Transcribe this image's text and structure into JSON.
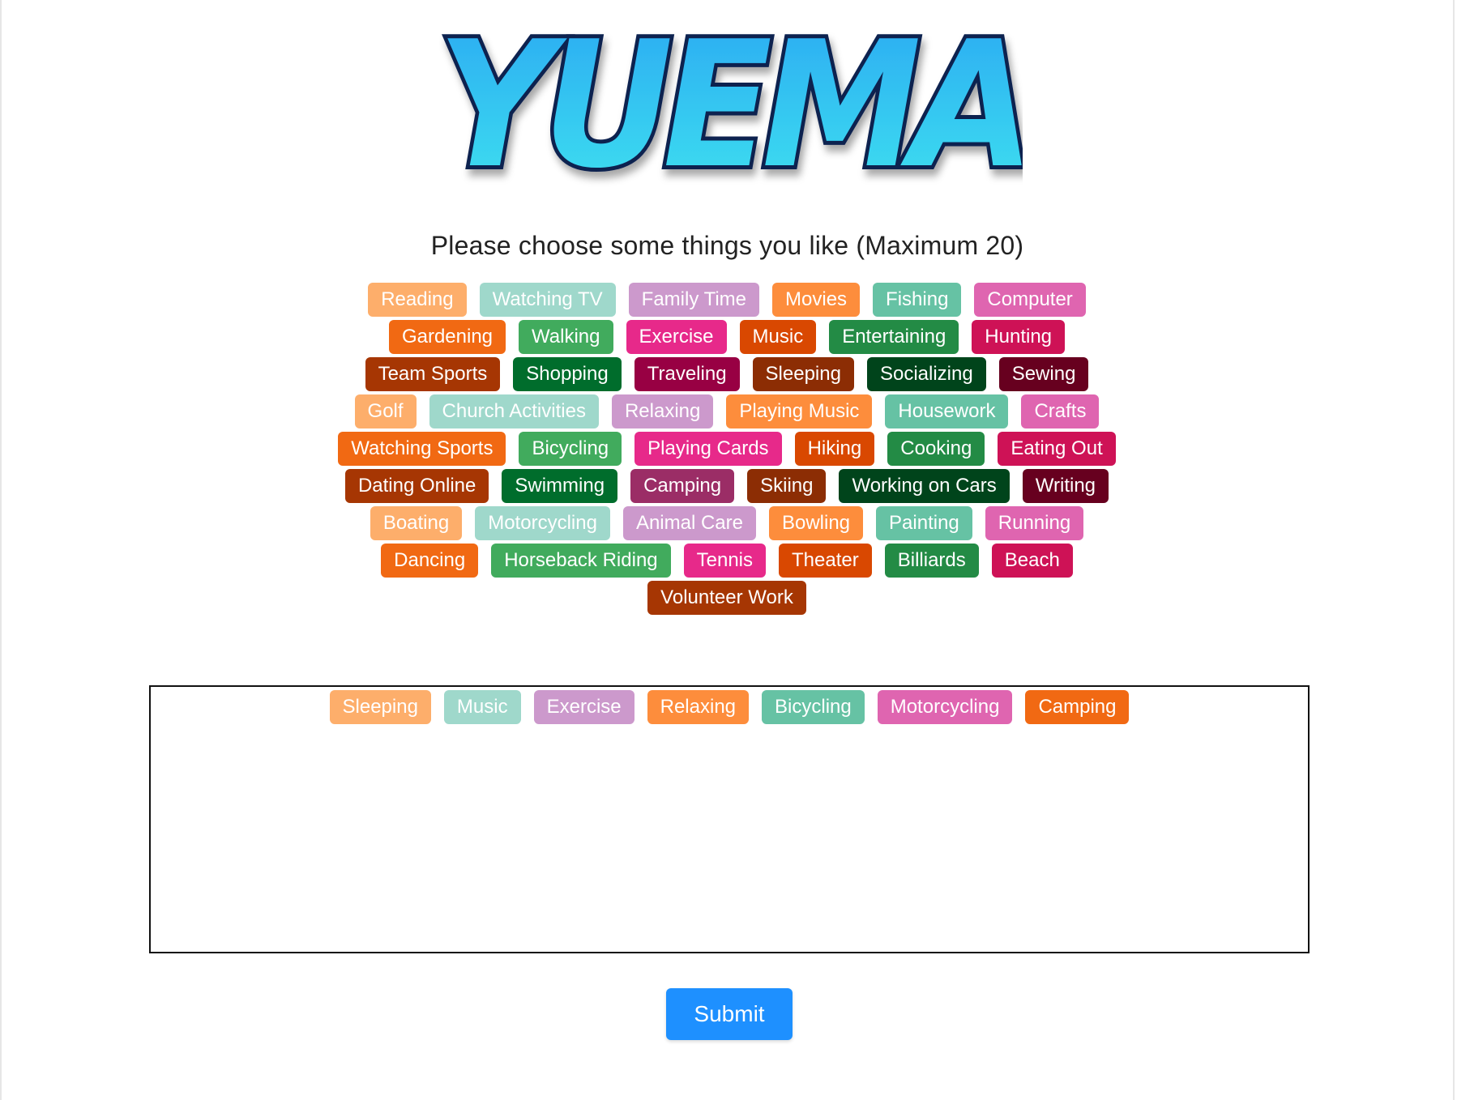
{
  "brand": {
    "name": "YUEMA"
  },
  "prompt": "Please choose some things you like (Maximum 20)",
  "interests": [
    {
      "label": "Reading",
      "color": "#fdae6b"
    },
    {
      "label": "Watching TV",
      "color": "#9fd8cb"
    },
    {
      "label": "Family Time",
      "color": "#cc99cc"
    },
    {
      "label": "Movies",
      "color": "#fd8d3c"
    },
    {
      "label": "Fishing",
      "color": "#66c2a4"
    },
    {
      "label": "Computer",
      "color": "#df65b0"
    },
    {
      "label": "Gardening",
      "color": "#f16913"
    },
    {
      "label": "Walking",
      "color": "#41ab5d"
    },
    {
      "label": "Exercise",
      "color": "#e7298a"
    },
    {
      "label": "Music",
      "color": "#d94801"
    },
    {
      "label": "Entertaining",
      "color": "#238b45"
    },
    {
      "label": "Hunting",
      "color": "#ce1256"
    },
    {
      "label": "Team Sports",
      "color": "#a63603"
    },
    {
      "label": "Shopping",
      "color": "#006d2c"
    },
    {
      "label": "Traveling",
      "color": "#980043"
    },
    {
      "label": "Sleeping",
      "color": "#8c2d04"
    },
    {
      "label": "Socializing",
      "color": "#00441b"
    },
    {
      "label": "Sewing",
      "color": "#67001f"
    },
    {
      "label": "Golf",
      "color": "#fdae6b"
    },
    {
      "label": "Church Activities",
      "color": "#9fd8cb"
    },
    {
      "label": "Relaxing",
      "color": "#cc99cc"
    },
    {
      "label": "Playing Music",
      "color": "#fd8d3c"
    },
    {
      "label": "Housework",
      "color": "#66c2a4"
    },
    {
      "label": "Crafts",
      "color": "#df65b0"
    },
    {
      "label": "Watching Sports",
      "color": "#f16913"
    },
    {
      "label": "Bicycling",
      "color": "#41ab5d"
    },
    {
      "label": "Playing Cards",
      "color": "#e7298a"
    },
    {
      "label": "Hiking",
      "color": "#d94801"
    },
    {
      "label": "Cooking",
      "color": "#238b45"
    },
    {
      "label": "Eating Out",
      "color": "#ce1256"
    },
    {
      "label": "Dating Online",
      "color": "#a63603"
    },
    {
      "label": "Swimming",
      "color": "#006d2c"
    },
    {
      "label": "Camping",
      "color": "#9b2d66"
    },
    {
      "label": "Skiing",
      "color": "#8c2d04"
    },
    {
      "label": "Working on Cars",
      "color": "#00441b"
    },
    {
      "label": "Writing",
      "color": "#67001f"
    },
    {
      "label": "Boating",
      "color": "#fdae6b"
    },
    {
      "label": "Motorcycling",
      "color": "#9fd8cb"
    },
    {
      "label": "Animal Care",
      "color": "#cc99cc"
    },
    {
      "label": "Bowling",
      "color": "#fd8d3c"
    },
    {
      "label": "Painting",
      "color": "#66c2a4"
    },
    {
      "label": "Running",
      "color": "#df65b0"
    },
    {
      "label": "Dancing",
      "color": "#f16913"
    },
    {
      "label": "Horseback Riding",
      "color": "#41ab5d"
    },
    {
      "label": "Tennis",
      "color": "#e7298a"
    },
    {
      "label": "Theater",
      "color": "#d94801"
    },
    {
      "label": "Billiards",
      "color": "#238b45"
    },
    {
      "label": "Beach",
      "color": "#ce1256"
    },
    {
      "label": "Volunteer Work",
      "color": "#a63603"
    }
  ],
  "selected": [
    {
      "label": "Sleeping",
      "color": "#fdae6b"
    },
    {
      "label": "Music",
      "color": "#9fd8cb"
    },
    {
      "label": "Exercise",
      "color": "#cc99cc"
    },
    {
      "label": "Relaxing",
      "color": "#fd8d3c"
    },
    {
      "label": "Bicycling",
      "color": "#66c2a4"
    },
    {
      "label": "Motorcycling",
      "color": "#df65b0"
    },
    {
      "label": "Camping",
      "color": "#f16913"
    }
  ],
  "submit_label": "Submit",
  "colors": {
    "accent": "#1e90ff"
  }
}
